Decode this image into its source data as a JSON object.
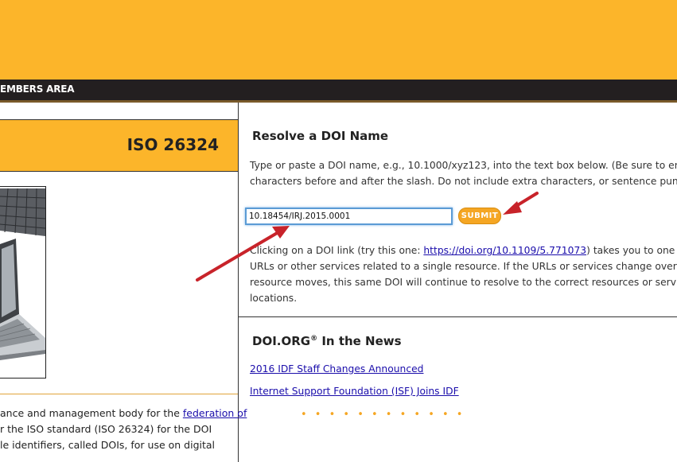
{
  "nav": {
    "members_area": "EMBERS AREA"
  },
  "left": {
    "iso_title": "ISO 26324",
    "para_line1_pre": "ance and management body for the ",
    "para_line1_link": "federation of",
    "para_line2": "r the ISO standard (ISO 26324) for the DOI",
    "para_line3": "le identifiers, called DOIs, for use on digital"
  },
  "resolve": {
    "heading": "Resolve a DOI Name",
    "instr_line1": "Type or paste a DOI name, e.g., 10.1000/xyz123, into the text box below. (Be sure to enter",
    "instr_line2": "characters before and after the slash. Do not include extra characters, or sentence punctua",
    "input_value": "10.18454/IRJ.2015.0001",
    "submit_label": "SUBMIT",
    "link_line1_pre": "Clicking on a DOI link (try this one: ",
    "link_url": "https://doi.org/10.1109/5.771073",
    "link_line1_post": ") takes you to one or m",
    "link_line2": "URLs or other services related to a single resource. If the URLs or services change over time",
    "link_line3": "resource moves, this same DOI will continue to resolve to the correct resources or services a",
    "link_line4": "locations."
  },
  "news": {
    "heading": "DOI.ORG",
    "heading_sup": "®",
    "heading_tail": " In the News",
    "items": [
      "2016 IDF Staff Changes Announced",
      "Internet Support Foundation (ISF) Joins IDF"
    ],
    "dots": "• • • • • • • • • • • •"
  },
  "colors": {
    "brand_orange": "#fcb52a",
    "nav_dark": "#231f20",
    "link_blue": "#1a0dab",
    "annotation_arrow": "#c8232a"
  }
}
